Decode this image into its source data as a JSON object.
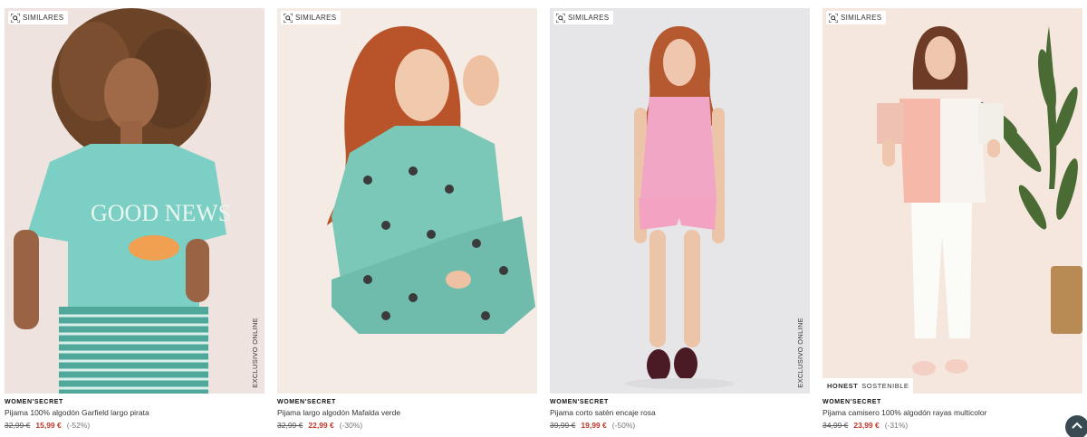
{
  "products": [
    {
      "similar_label": "SIMILARES",
      "brand": "WOMEN'SECRET",
      "name": "Pijama 100% algodón Garfield largo pirata",
      "old_price": "32,99 €",
      "price": "15,99 €",
      "discount": "(-52%)",
      "vertical_tag": "EXCLUSIVO ONLINE",
      "shirt_print": "GOOD NEWS"
    },
    {
      "similar_label": "SIMILARES",
      "brand": "WOMEN'SECRET",
      "name": "Pijama largo algodón Mafalda verde",
      "old_price": "32,99 €",
      "price": "22,99 €",
      "discount": "(-30%)"
    },
    {
      "similar_label": "SIMILARES",
      "brand": "WOMEN'SECRET",
      "name": "Pijama corto satén encaje rosa",
      "old_price": "39,99 €",
      "price": "19,99 €",
      "discount": "(-50%)",
      "vertical_tag": "EXCLUSIVO ONLINE"
    },
    {
      "similar_label": "SIMILARES",
      "brand": "WOMEN'SECRET",
      "name": "Pijama camisero 100% algodón rayas multicolor",
      "old_price": "34,99 €",
      "price": "23,99 €",
      "discount": "(-31%)",
      "badge_bold": "HONEST",
      "badge_text": "SOSTENIBLE"
    }
  ],
  "icons": {
    "similar": "visual-search-icon",
    "scroll_top": "chevron-up-icon"
  },
  "colors": {
    "sale_price": "#c0392b",
    "scroll_button": "#3a4a52"
  }
}
